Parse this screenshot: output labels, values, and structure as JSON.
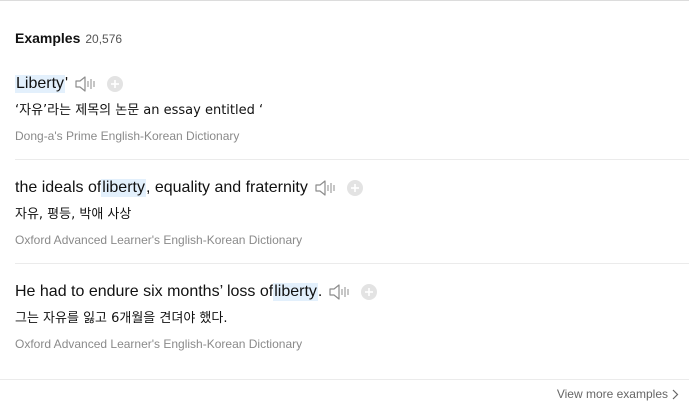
{
  "examples": {
    "title": "Examples",
    "count": "20,576",
    "entries": [
      {
        "pre": "",
        "highlight": "Liberty",
        "post": "'",
        "translation": "‘자유’라는 제목의 논문 an essay entitled ‘",
        "source": "Dong-a's Prime English-Korean Dictionary"
      },
      {
        "pre": "the ideals of ",
        "highlight": "liberty",
        "post": ", equality and fraternity",
        "translation": "자유, 평등, 박애 사상",
        "source": "Oxford Advanced Learner's English-Korean Dictionary"
      },
      {
        "pre": "He had to endure six months’ loss of ",
        "highlight": "liberty",
        "post": ".",
        "translation": "그는 자유를 잃고 6개월을 견뎌야 했다.",
        "source": "Oxford Advanced Learner's English-Korean Dictionary"
      }
    ],
    "more_label": "View more examples"
  },
  "icons": {
    "speaker": "speaker-icon",
    "add": "plus-circle-icon",
    "chevron": "chevron-right-icon"
  },
  "colors": {
    "highlight_bg": "#e3f0fc",
    "source_text": "#8a8a8a",
    "icon_gray": "#b5b5b5"
  }
}
